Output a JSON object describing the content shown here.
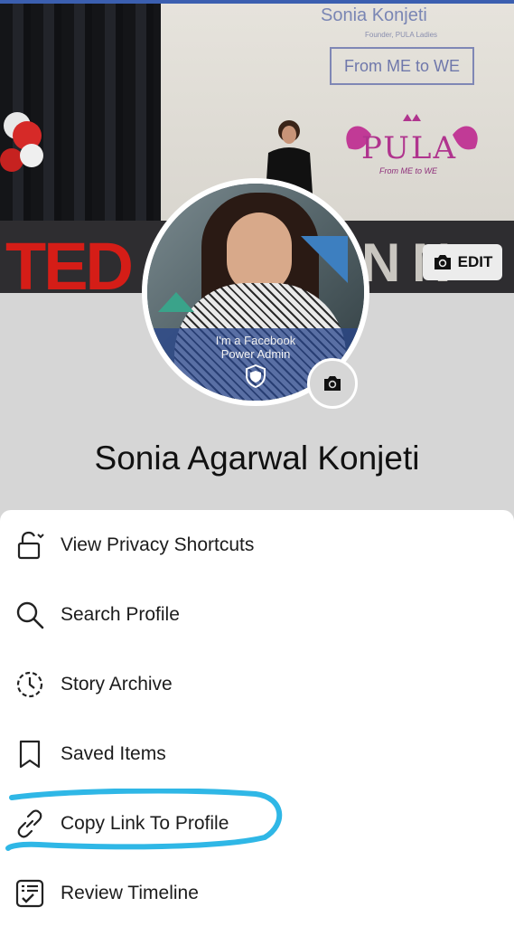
{
  "cover": {
    "screen_name": "Sonia Konjeti",
    "screen_subtitle": "Founder, PULA Ladies",
    "screen_box_text": "From ME to WE",
    "logo_text": "PULA",
    "logo_tagline": "From ME to WE",
    "stage_text": "TED",
    "stage_letters": "N N",
    "edit_label": "EDIT"
  },
  "avatar": {
    "frame_text_line1": "I'm a Facebook",
    "frame_text_line2": "Power Admin"
  },
  "profile": {
    "name": "Sonia Agarwal Konjeti"
  },
  "menu": {
    "items": [
      {
        "label": "View Privacy Shortcuts",
        "icon": "lock-icon"
      },
      {
        "label": "Search Profile",
        "icon": "search-icon"
      },
      {
        "label": "Story Archive",
        "icon": "clock-archive-icon"
      },
      {
        "label": "Saved Items",
        "icon": "bookmark-icon"
      },
      {
        "label": "Copy Link To Profile",
        "icon": "link-icon",
        "highlighted": true
      },
      {
        "label": "Review Timeline",
        "icon": "review-list-icon"
      }
    ]
  },
  "colors": {
    "highlight_stroke": "#2fb7e6",
    "top_strip": "#3b5fb0",
    "ted_red": "#d51d17"
  }
}
